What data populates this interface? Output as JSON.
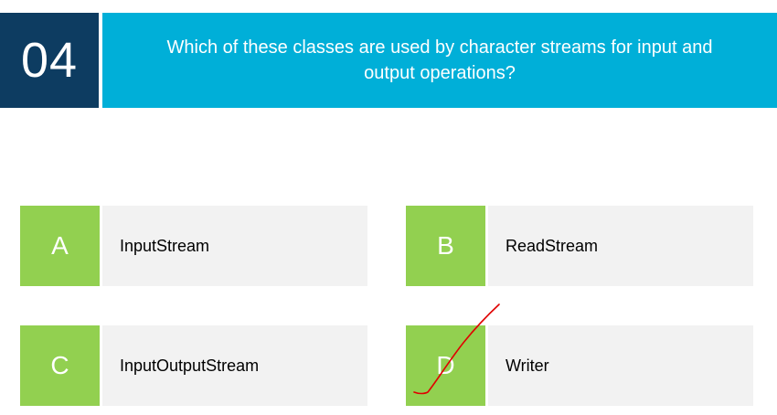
{
  "question": {
    "number": "04",
    "text": "Which of these classes are used by character streams for input and output operations?"
  },
  "options": [
    {
      "letter": "A",
      "text": "InputStream"
    },
    {
      "letter": "B",
      "text": "ReadStream"
    },
    {
      "letter": "C",
      "text": "InputOutputStream"
    },
    {
      "letter": "D",
      "text": "Writer"
    }
  ],
  "colors": {
    "number_bg": "#0d3c61",
    "question_bg": "#00afd8",
    "letter_bg": "#92d050",
    "answer_bg": "#f2f2f2",
    "tick_mark": "#e00000"
  }
}
